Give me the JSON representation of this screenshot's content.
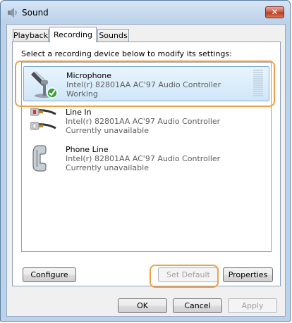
{
  "window": {
    "title": "Sound",
    "icon": "speaker-icon",
    "close_glyph": "✕"
  },
  "tabs": [
    {
      "label": "Playback",
      "active": false
    },
    {
      "label": "Recording",
      "active": true
    },
    {
      "label": "Sounds",
      "active": false
    }
  ],
  "instruction": "Select a recording device below to modify its settings:",
  "devices": [
    {
      "name": "Microphone",
      "description": "Intel(r) 82801AA AC'97 Audio Controller",
      "status": "Working",
      "icon": "microphone-icon",
      "selected": true,
      "default": true
    },
    {
      "name": "Line In",
      "description": "Intel(r) 82801AA AC'97 Audio Controller",
      "status": "Currently unavailable",
      "icon": "line-in-cable-icon",
      "selected": false
    },
    {
      "name": "Phone Line",
      "description": "Intel(r) 82801AA AC'97 Audio Controller",
      "status": "Currently unavailable",
      "icon": "telephone-icon",
      "selected": false
    }
  ],
  "buttons": {
    "configure": "Configure",
    "set_default": "Set Default",
    "properties": "Properties",
    "ok": "OK",
    "cancel": "Cancel",
    "apply": "Apply"
  },
  "colors": {
    "highlight": "#f0a044",
    "selection": "#cfe6f8",
    "default_check": "#3aa03a"
  }
}
